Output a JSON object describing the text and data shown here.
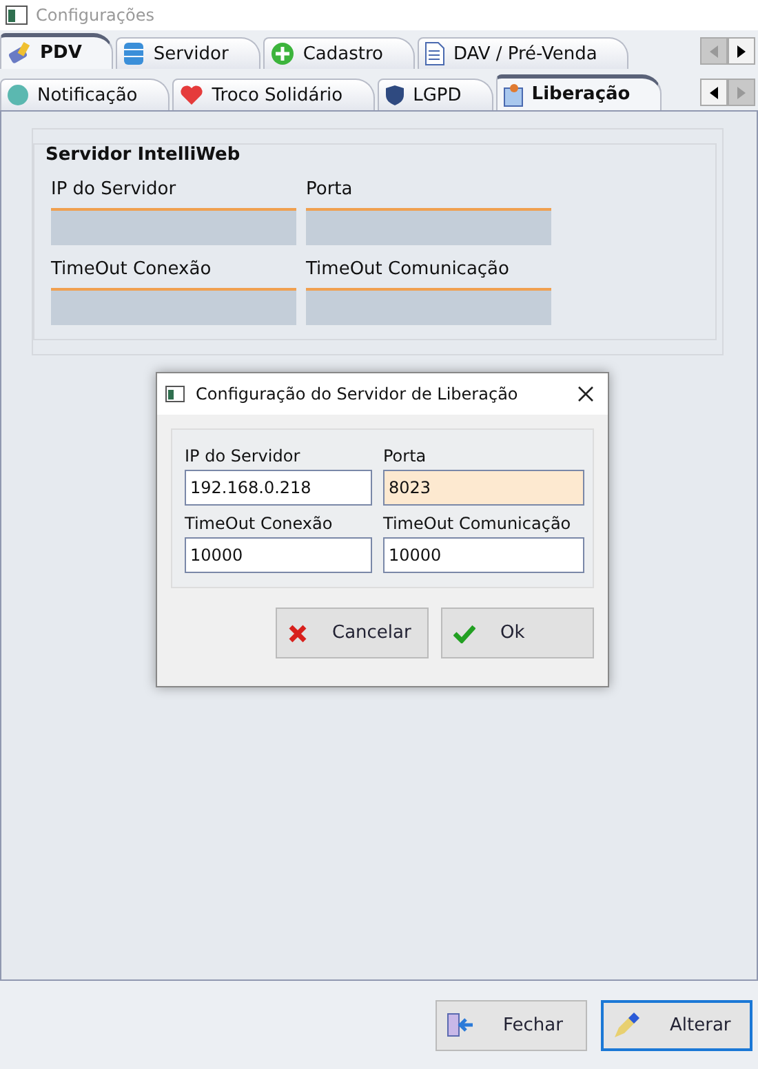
{
  "window": {
    "title": "Configurações"
  },
  "tab_rows": [
    {
      "tabs": [
        {
          "label": "PDV",
          "selected": true
        },
        {
          "label": "Servidor",
          "selected": false
        },
        {
          "label": "Cadastro",
          "selected": false
        },
        {
          "label": "DAV / Pré-Venda",
          "selected": false
        }
      ],
      "scroll_left_disabled": true,
      "scroll_right_disabled": false
    },
    {
      "tabs": [
        {
          "label": "Notificação",
          "selected": false
        },
        {
          "label": "Troco Solidário",
          "selected": false
        },
        {
          "label": "LGPD",
          "selected": false
        },
        {
          "label": "Liberação",
          "selected": true
        }
      ],
      "scroll_left_disabled": false,
      "scroll_right_disabled": true
    }
  ],
  "group": {
    "title": "Servidor IntelliWeb",
    "fields": [
      {
        "label": "IP do Servidor"
      },
      {
        "label": "Porta"
      },
      {
        "label": "TimeOut Conexão"
      },
      {
        "label": "TimeOut Comunicação"
      }
    ]
  },
  "dialog": {
    "title": "Configuração do Servidor de Liberação",
    "fields": [
      {
        "label": "IP do Servidor",
        "value": "192.168.0.218",
        "focused": false
      },
      {
        "label": "Porta",
        "value": "8023",
        "focused": true
      },
      {
        "label": "TimeOut Conexão",
        "value": "10000",
        "focused": false
      },
      {
        "label": "TimeOut Comunicação",
        "value": "10000",
        "focused": false
      }
    ],
    "buttons": [
      {
        "label": "Cancelar",
        "focused": false
      },
      {
        "label": "Ok",
        "focused": false
      }
    ]
  },
  "footer_buttons": [
    {
      "label": "Fechar",
      "focused": false
    },
    {
      "label": "Alterar",
      "focused": true
    }
  ]
}
